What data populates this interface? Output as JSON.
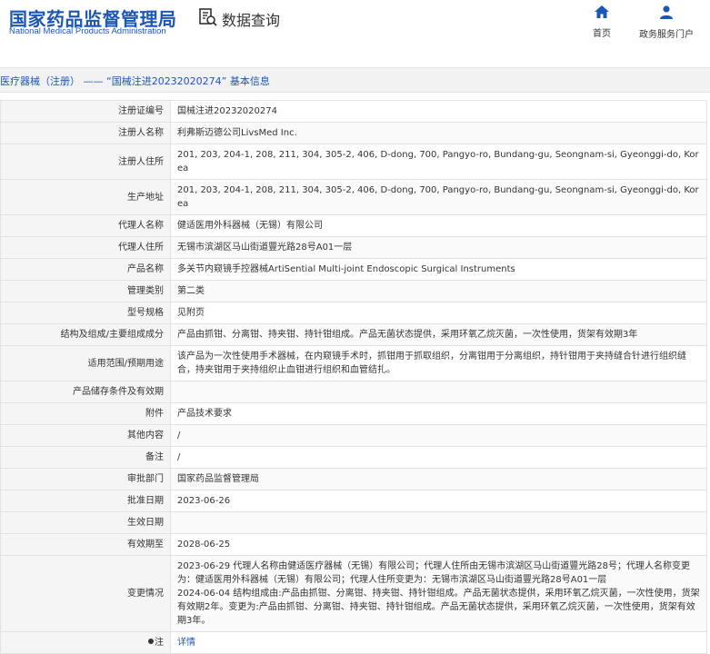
{
  "header": {
    "org_name_cn": "国家药品监督管理局",
    "org_name_en": "National Medical Products Administration",
    "query_title": "数据查询",
    "nav": [
      {
        "label": "首页",
        "icon": "home-icon"
      },
      {
        "label": "政务服务门户",
        "icon": "user-icon"
      }
    ],
    "accent_color": "#1d57b5"
  },
  "titlebar": {
    "text": "医疗器械（注册） —— “国械注进20232020274” 基本信息"
  },
  "rows": [
    {
      "label": "注册证编号",
      "value": "国械注进20232020274"
    },
    {
      "label": "注册人名称",
      "value": "利弗斯迈德公司LivsMed Inc."
    },
    {
      "label": "注册人住所",
      "value": "201, 203, 204-1, 208, 211, 304, 305-2, 406, D-dong, 700, Pangyo-ro, Bundang-gu, Seongnam-si, Gyeonggi-do, Korea"
    },
    {
      "label": "生产地址",
      "value": "201, 203, 204-1, 208, 211, 304, 305-2, 406, D-dong, 700, Pangyo-ro, Bundang-gu, Seongnam-si, Gyeonggi-do, Korea"
    },
    {
      "label": "代理人名称",
      "value": "健适医用外科器械（无锡）有限公司"
    },
    {
      "label": "代理人住所",
      "value": "无锡市滨湖区马山街道豐光路28号A01一层"
    },
    {
      "label": "产品名称",
      "value": "多关节内窥镜手控器械ArtiSential Multi-joint Endoscopic Surgical Instruments"
    },
    {
      "label": "管理类别",
      "value": "第二类"
    },
    {
      "label": "型号规格",
      "value": "见附页"
    },
    {
      "label": "结构及组成/主要组成成分",
      "value": "产品由抓钳、分离钳、持夹钳、持针钳组成。产品无菌状态提供，采用环氧乙烷灭菌，一次性使用，货架有效期3年"
    },
    {
      "label": "适用范围/预期用途",
      "value": "该产品为一次性使用手术器械，在内窥镜手术时，抓钳用于抓取组织，分离钳用于分离组织，持针钳用于夹持缝合针进行组织缝合，持夹钳用于夹持组织止血钳进行组织和血管结扎。"
    },
    {
      "label": "产品储存条件及有效期",
      "value": ""
    },
    {
      "label": "附件",
      "value": "产品技术要求"
    },
    {
      "label": "其他内容",
      "value": "/"
    },
    {
      "label": "备注",
      "value": "/"
    },
    {
      "label": "审批部门",
      "value": "国家药品监督管理局"
    },
    {
      "label": "批准日期",
      "value": "2023-06-26"
    },
    {
      "label": "生效日期",
      "value": ""
    },
    {
      "label": "有效期至",
      "value": "2028-06-25"
    }
  ],
  "change_row": {
    "label": "变更情况",
    "lines": [
      "2023-06-29 代理人名称由健适医疗器械（无锡）有限公司；代理人住所由无锡市滨湖区马山街道豐光路28号；代理人名称变更为：健适医用外科器械（无锡）有限公司；代理人住所变更为：无锡市滨湖区马山街道豐光路28号A01一层",
      "2024-06-04 结构组成由:产品由抓钳、分离钳、持夹钳、持针钳组成。产品无菌状态提供，采用环氧乙烷灭菌，一次性使用，货架有效期2年。变更为:产品由抓钳、分离钳、持夹钳、持针钳组成。产品无菌状态提供，采用环氧乙烷灭菌，一次性使用，货架有效期3年。"
    ]
  },
  "note_row": {
    "label": "注",
    "link": "详情",
    "icon": "bullet-icon"
  }
}
